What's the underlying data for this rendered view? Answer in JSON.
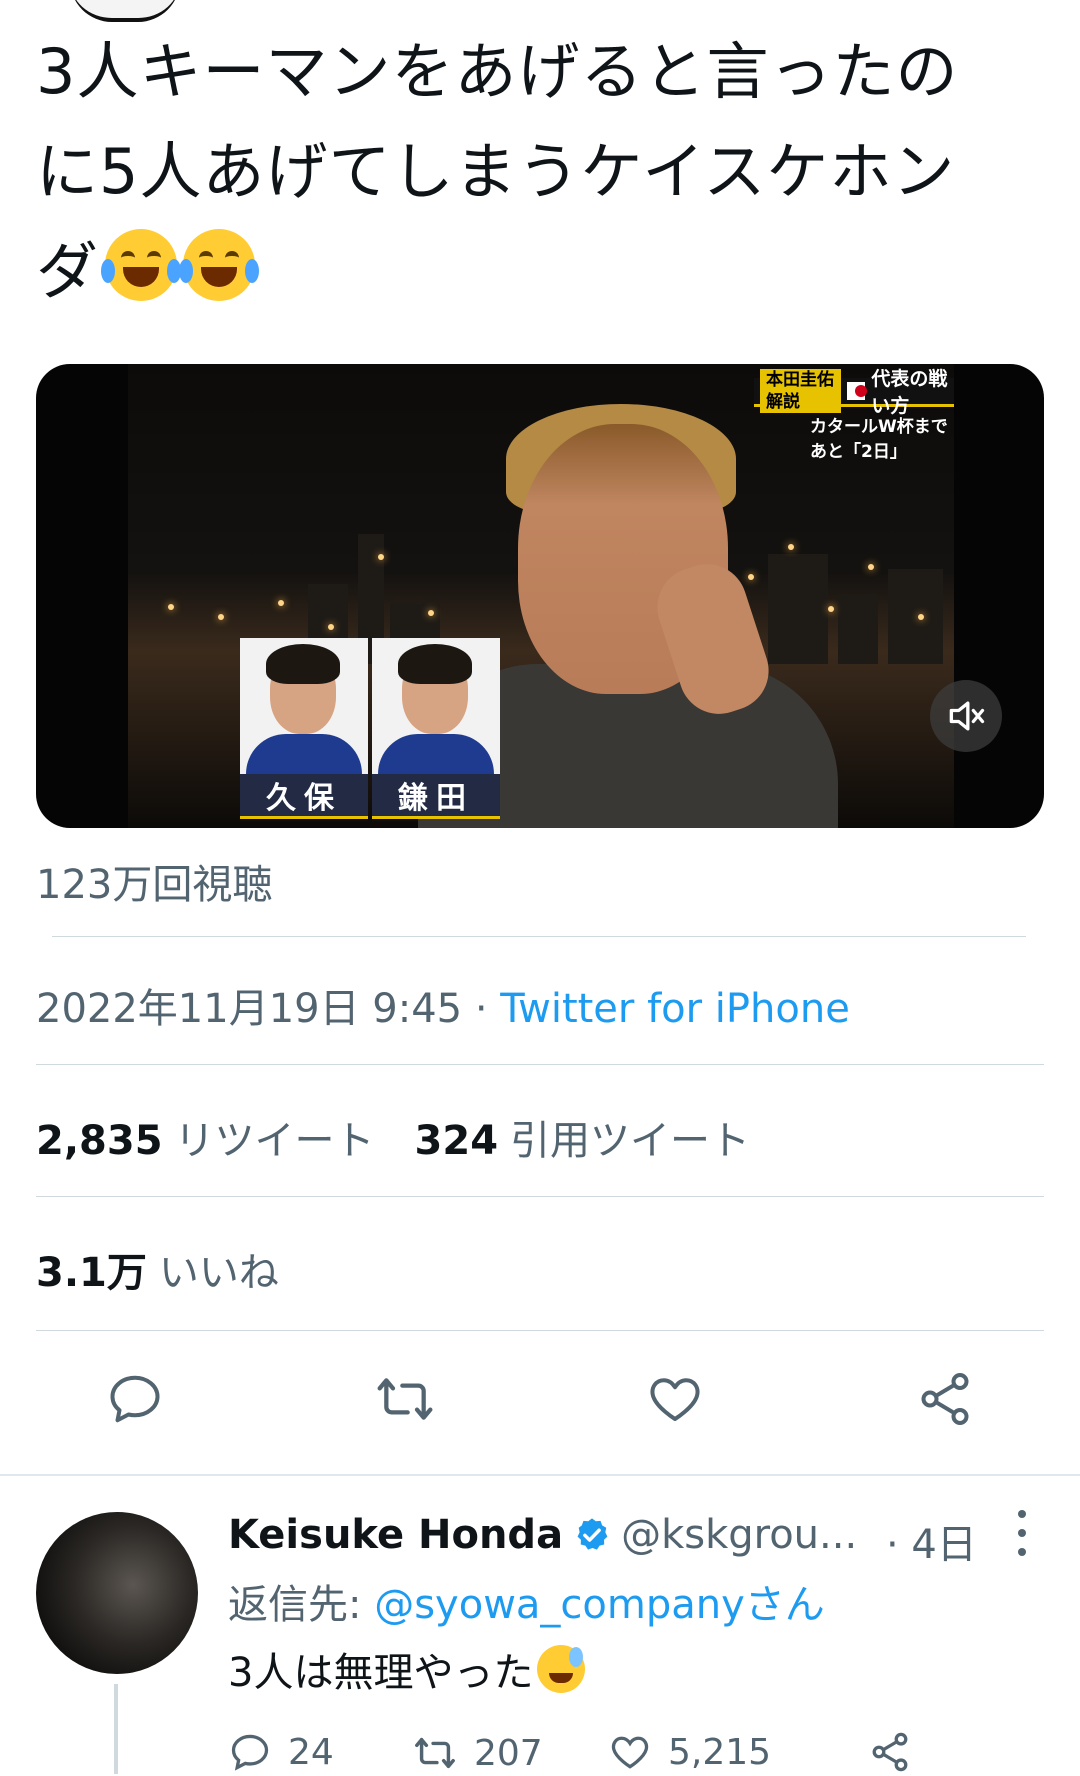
{
  "tweet": {
    "text_line1": "3人キーマンをあげると言ったの",
    "text_line2": "に5人あげてしまうケイスケホン",
    "text_line3": "ダ",
    "emojis": [
      "face-with-tears-of-joy",
      "face-with-tears-of-joy"
    ],
    "media": {
      "overlay_tag_label": "本田圭佑解説",
      "overlay_tag_title": "代表の戦い方",
      "overlay_subtitle": "カタールW杯まで あと「2日」",
      "players": [
        "久保",
        "鎌田"
      ],
      "mute_icon": "speaker-muted-icon"
    },
    "views": "123万回視聴",
    "date": "2022年11月19日 9:45",
    "separator": " · ",
    "source": "Twitter for iPhone",
    "retweets_count": "2,835",
    "retweets_label": "リツイート",
    "quotes_count": "324",
    "quotes_label": "引用ツイート",
    "likes_count": "3.1万",
    "likes_label": "いいね"
  },
  "reply": {
    "name": "Keisuke Honda",
    "handle": "@kskgrou...",
    "time": "· 4日",
    "reply_to_label": "返信先: ",
    "reply_to_mention": "@syowa_companyさん",
    "text": "3人は無理やった",
    "emoji": "grinning-face-with-sweat",
    "replies": "24",
    "retweets": "207",
    "likes": "5,215"
  },
  "colors": {
    "accent": "#1d9bf0",
    "text": "#0f1419",
    "secondary": "#536471"
  }
}
